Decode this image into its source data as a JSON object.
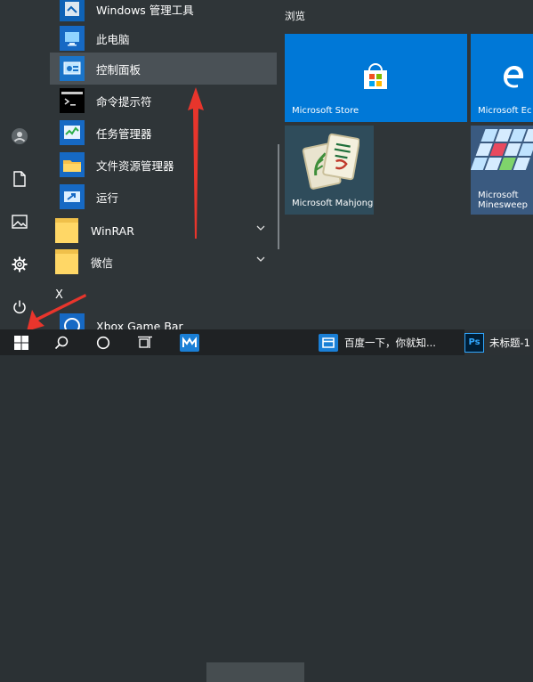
{
  "apps": [
    {
      "label": "Windows 管理工具",
      "icon": "admin-tools-icon"
    },
    {
      "label": "此电脑",
      "icon": "this-pc-icon"
    },
    {
      "label": "控制面板",
      "icon": "control-panel-icon",
      "selected": true
    },
    {
      "label": "命令提示符",
      "icon": "command-prompt-icon"
    },
    {
      "label": "任务管理器",
      "icon": "task-manager-icon"
    },
    {
      "label": "文件资源管理器",
      "icon": "file-explorer-icon"
    },
    {
      "label": "运行",
      "icon": "run-icon"
    }
  ],
  "folders": [
    {
      "label": "WinRAR",
      "icon": "folder-icon"
    },
    {
      "label": "微信",
      "icon": "folder-icon"
    }
  ],
  "section_letter": "X",
  "xbox_label": "Xbox Game Bar",
  "tiles": {
    "group_title": "浏览",
    "items": [
      {
        "label": "Microsoft Store",
        "icon": "store-icon",
        "color": "#0078d7"
      },
      {
        "label": "Microsoft Ec",
        "icon": "edge-icon",
        "color": "#0078d7"
      },
      {
        "label": "Microsoft Mahjong",
        "icon": "mahjong-icon",
        "color": "#2f4c5b"
      },
      {
        "label": "Microsoft Minesweeper",
        "lines": [
          "Microsoft",
          "Minesweep"
        ],
        "icon": "minesweeper-icon",
        "color": "#3a5a80"
      }
    ]
  },
  "taskbar": {
    "items": [
      {
        "label": "百度一下，你就知...",
        "icon": "browser-icon"
      },
      {
        "label": "未标题-1",
        "icon": "photoshop-icon",
        "icon_text": "Ps"
      }
    ]
  },
  "colors": {
    "accent": "#0078d7",
    "arrow": "#e8352c"
  }
}
